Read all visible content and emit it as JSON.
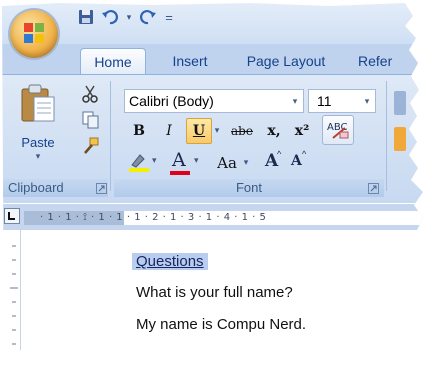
{
  "quick_access": {
    "save_icon": "save-icon",
    "undo_icon": "undo-icon",
    "redo_icon": "redo-icon",
    "customize_label": "="
  },
  "tabs": [
    {
      "label": "Home",
      "active": true
    },
    {
      "label": "Insert"
    },
    {
      "label": "Page Layout"
    },
    {
      "label": "Refer"
    }
  ],
  "clipboard": {
    "paste_label": "Paste",
    "group_label": "Clipboard"
  },
  "font": {
    "font_name": "Calibri (Body)",
    "font_size": "11",
    "bold_label": "B",
    "italic_label": "I",
    "underline_label": "U",
    "strike_label": "abe",
    "subscript_label": "x,",
    "superscript_label": "x²",
    "change_case_label": "Aa",
    "grow_font_label": "A",
    "shrink_font_label": "A",
    "font_color_label": "A",
    "group_label": "Font"
  },
  "ruler": {
    "numbers": "· 1 · 1 · ⟟ · 1 · 1 · 1 · 2 · 1 · 3 · 1 · 4 · 1 · 5"
  },
  "document": {
    "lines": [
      "Questions",
      "What is your full name?",
      "My name is Compu Nerd."
    ]
  },
  "colors": {
    "highlight": "#f4f000",
    "font_color": "#e0001b",
    "selection": "#b9cdf0"
  }
}
